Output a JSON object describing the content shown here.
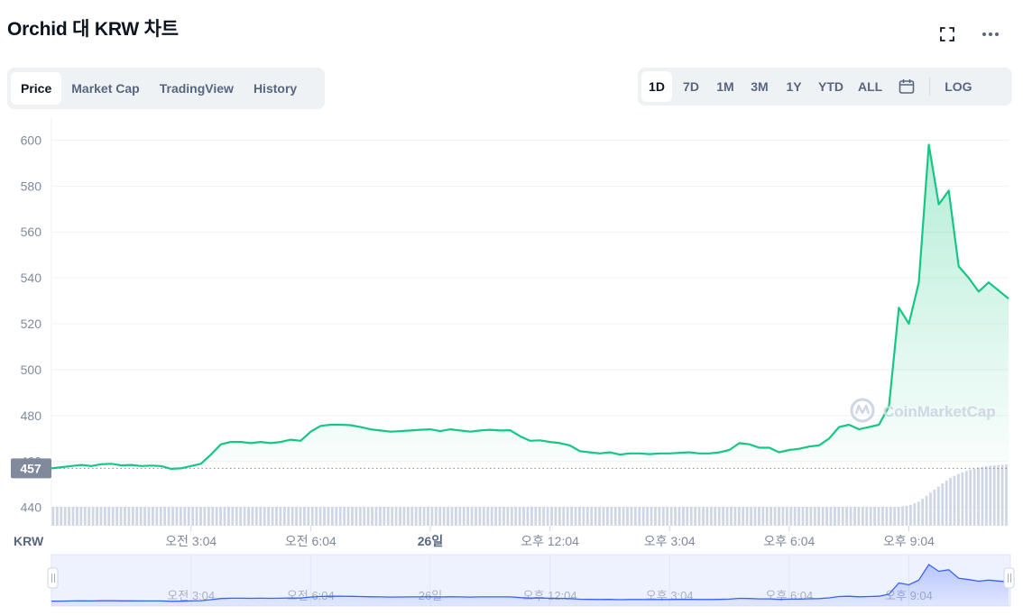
{
  "header": {
    "title": "Orchid 대 KRW 차트"
  },
  "tabs": [
    {
      "label": "Price",
      "active": true
    },
    {
      "label": "Market Cap",
      "active": false
    },
    {
      "label": "TradingView",
      "active": false
    },
    {
      "label": "History",
      "active": false
    }
  ],
  "ranges": [
    {
      "label": "1D",
      "active": true
    },
    {
      "label": "7D",
      "active": false
    },
    {
      "label": "1M",
      "active": false
    },
    {
      "label": "3M",
      "active": false
    },
    {
      "label": "1Y",
      "active": false
    },
    {
      "label": "YTD",
      "active": false
    },
    {
      "label": "ALL",
      "active": false
    }
  ],
  "log_label": "LOG",
  "watermark": "CoinMarketCap",
  "colors": {
    "line": "#16c784",
    "volume": "#cfd6e4",
    "navigator": "#3861fb",
    "price_tag": "#808a9d"
  },
  "chart_data": {
    "type": "area",
    "currency_label": "KRW",
    "current_price_label": "457",
    "ylim": [
      432,
      610
    ],
    "y_ticks": [
      440,
      460,
      480,
      500,
      520,
      540,
      560,
      580,
      600
    ],
    "y_tick_labels": [
      "440",
      "460",
      "480",
      "500",
      "520",
      "540",
      "560",
      "580",
      "600"
    ],
    "x_tick_labels": [
      "오전 3:04",
      "오전 6:04",
      "26일",
      "오후 12:04",
      "오후 3:04",
      "오후 6:04",
      "오후 9:04"
    ],
    "x_tick_positions": [
      2.0,
      5.0,
      8.0,
      11.0,
      14.0,
      17.0,
      20.0
    ],
    "xlim": [
      -1.5,
      22.5
    ],
    "grid": true,
    "series": [
      {
        "x": [
          -1.5,
          -1.25,
          -1.0,
          -0.75,
          -0.5,
          -0.25,
          0.0,
          0.25,
          0.5,
          0.75,
          1.0,
          1.25,
          1.5,
          1.75,
          2.0,
          2.25,
          2.5,
          2.75,
          3.0,
          3.25,
          3.5,
          3.75,
          4.0,
          4.25,
          4.5,
          4.75,
          5.0,
          5.25,
          5.5,
          5.75,
          6.0,
          6.25,
          6.5,
          6.75,
          7.0,
          7.25,
          7.5,
          7.75,
          8.0,
          8.25,
          8.5,
          8.75,
          9.0,
          9.25,
          9.5,
          9.75,
          10.0,
          10.25,
          10.5,
          10.75,
          11.0,
          11.25,
          11.5,
          11.75,
          12.0,
          12.25,
          12.5,
          12.75,
          13.0,
          13.25,
          13.5,
          13.75,
          14.0,
          14.25,
          14.5,
          14.75,
          15.0,
          15.25,
          15.5,
          15.75,
          16.0,
          16.25,
          16.5,
          16.75,
          17.0,
          17.25,
          17.5,
          17.75,
          18.0,
          18.25,
          18.5,
          18.75,
          19.0,
          19.25,
          19.5,
          19.75,
          20.0,
          20.25,
          20.5,
          20.75,
          21.0,
          21.25,
          21.5,
          21.75,
          22.0,
          22.5
        ],
        "values": [
          457,
          457.5,
          458,
          458.5,
          458,
          458.8,
          459,
          458.3,
          458.5,
          458,
          458.2,
          458,
          456.8,
          457,
          458,
          459,
          463,
          467.5,
          468.5,
          468.5,
          468,
          468.5,
          468,
          468.5,
          469.5,
          469,
          473,
          475.5,
          476,
          476,
          475.8,
          475,
          474,
          473.5,
          473,
          473.2,
          473.5,
          473.8,
          474,
          473.2,
          474,
          473.5,
          473,
          473.5,
          473.8,
          473.5,
          473.6,
          471,
          469,
          469.2,
          468.5,
          468,
          467,
          464.5,
          464,
          463.5,
          464,
          463,
          463.5,
          463.5,
          463.2,
          463.5,
          463.5,
          463.8,
          464,
          463.5,
          463.5,
          464,
          465,
          468,
          467.5,
          466,
          466,
          464,
          465,
          465.5,
          466.5,
          467,
          470,
          475,
          476,
          474,
          475,
          476,
          484,
          527,
          520,
          538,
          598,
          572,
          578,
          545,
          540,
          534,
          538,
          531
        ],
        "volume": [
          0.3,
          0.3,
          0.3,
          0.3,
          0.3,
          0.3,
          0.3,
          0.3,
          0.3,
          0.3,
          0.3,
          0.3,
          0.3,
          0.3,
          0.3,
          0.3,
          0.3,
          0.3,
          0.3,
          0.3,
          0.3,
          0.3,
          0.3,
          0.3,
          0.3,
          0.3,
          0.3,
          0.3,
          0.3,
          0.3,
          0.3,
          0.3,
          0.3,
          0.3,
          0.3,
          0.3,
          0.3,
          0.3,
          0.3,
          0.3,
          0.3,
          0.3,
          0.3,
          0.3,
          0.3,
          0.3,
          0.3,
          0.3,
          0.3,
          0.3,
          0.3,
          0.3,
          0.3,
          0.3,
          0.3,
          0.3,
          0.3,
          0.3,
          0.3,
          0.3,
          0.3,
          0.3,
          0.3,
          0.3,
          0.3,
          0.3,
          0.3,
          0.3,
          0.3,
          0.3,
          0.3,
          0.3,
          0.3,
          0.3,
          0.3,
          0.3,
          0.3,
          0.3,
          0.3,
          0.3,
          0.3,
          0.3,
          0.3,
          0.3,
          0.3,
          0.3,
          0.32,
          0.38,
          0.5,
          0.62,
          0.74,
          0.82,
          0.88,
          0.92,
          0.95,
          0.97
        ]
      }
    ]
  }
}
